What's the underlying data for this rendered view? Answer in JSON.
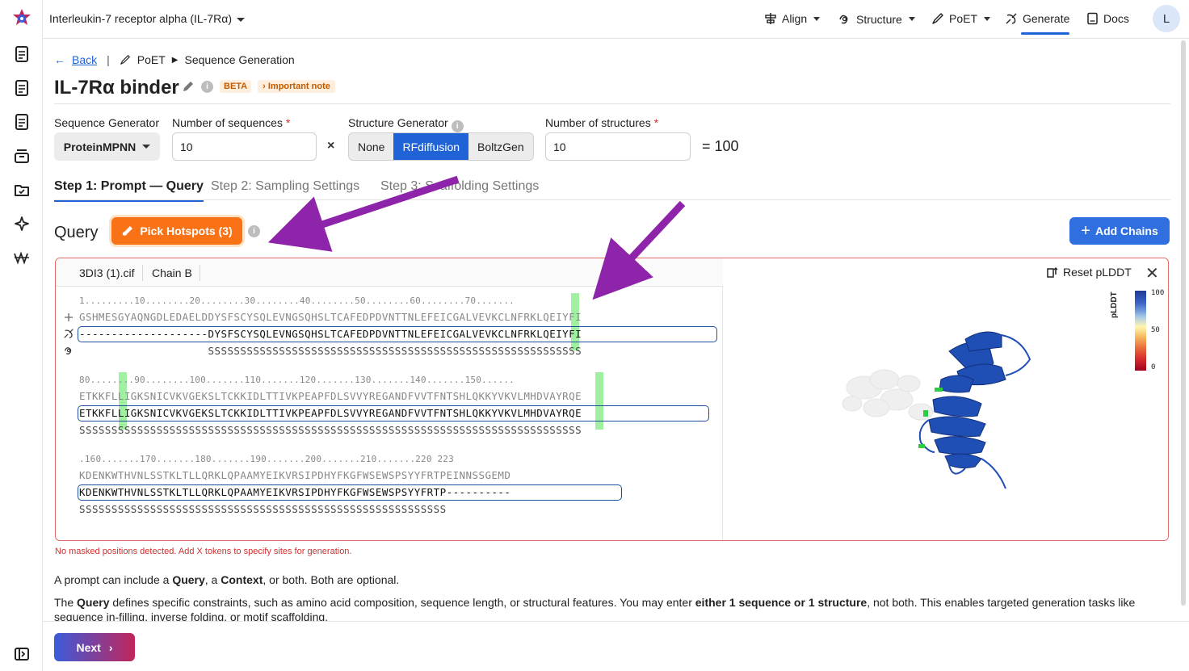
{
  "header": {
    "project_title": "Interleukin-7 receptor alpha (IL-7Rα)",
    "nav": [
      {
        "label": "Align",
        "icon": "align-icon"
      },
      {
        "label": "Structure",
        "icon": "structure-icon"
      },
      {
        "label": "PoET",
        "icon": "poet-icon"
      },
      {
        "label": "Generate",
        "icon": "generate-icon",
        "active": true
      },
      {
        "label": "Docs",
        "icon": "docs-icon"
      }
    ],
    "avatar": "L"
  },
  "breadcrumb": {
    "back": "Back",
    "separator": "|",
    "poet": "PoET",
    "current": "Sequence Generation"
  },
  "page": {
    "title": "IL-7Rα binder",
    "beta": "BETA",
    "note": "Important note"
  },
  "form": {
    "seq_gen_label": "Sequence Generator",
    "seq_gen_value": "ProteinMPNN",
    "num_seq_label": "Number of sequences",
    "num_seq_value": "10",
    "times": "×",
    "struct_gen_label": "Structure Generator",
    "struct_options": [
      "None",
      "RFdiffusion",
      "BoltzGen"
    ],
    "struct_selected": "RFdiffusion",
    "num_struct_label": "Number of structures",
    "num_struct_value": "10",
    "total": "= 100",
    "required_mark": "*",
    "info": "i"
  },
  "tabs": [
    {
      "label": "Step 1: Prompt — Query",
      "active": true
    },
    {
      "label": "Step 2: Sampling Settings"
    },
    {
      "label": "Step 3: Scaffolding Settings"
    }
  ],
  "query": {
    "label": "Query",
    "pick_hotspots": "Pick Hotspots (3)",
    "add_chains": "Add Chains",
    "file_name": "3DI3 (1).cif",
    "chain": "Chain B",
    "reset_plddt": "Reset pLDDT",
    "close": "✕",
    "plddt_label": "pLDDT",
    "plddt_ticks": [
      "100",
      "50",
      "0"
    ],
    "rows": [
      {
        "ruler": "1.........10........20........30........40........50........60........70.......",
        "ref": "GSHMESGYAQNGDLEDAELDDYSFSCYSQLEVNGSQHSLTCAFEDPDVNTTNLEFEICGALVEVKCLNFRKLQEIYFI",
        "query": "--------------------DYSFSCYSQLEVNGSQHSLTCAFEDPDVNTTNLEFEICGALVEVKCLNFRKLQEIYFI",
        "ss": "                    SSSSSSSSSSSSSSSSSSSSSSSSSSSSSSSSSSSSSSSSSSSSSSSSSSSSSSSSSS"
      },
      {
        "ruler": "80........90........100.......110.......120.......130.......140.......150......",
        "ref": "ETKKFLLIGKSNICVKVGEKSLTCKKIDLTTIVKPEAPFDLSVVYREGANDFVVTFNTSHLQKKYVKVLMHDVAYRQE",
        "query": "ETKKFLLIGKSNICVKVGEKSLTCKKIDLTTIVKPEAPFDLSVVYREGANDFVVTFNTSHLQKKYVKVLMHDVAYRQE",
        "ss": "SSSSSSSSSSSSSSSSSSSSSSSSSSSSSSSSSSSSSSSSSSSSSSSSSSSSSSSSSSSSSSSSSSSSSSSSSSSSSS"
      },
      {
        "ruler": ".160.......170.......180.......190.......200.......210.......220 223",
        "ref": "KDENKWTHVNLSSTKLTLLQRKLQPAAMYEIKVRSIPDHYFKGFWSEWSPSYYFRTPEINNSSGEMD",
        "query": "KDENKWTHVNLSSTKLTLLQRKLQPAAMYEIKVRSIPDHYFKGFWSEWSPSYYFRTP----------",
        "ss": "SSSSSSSSSSSSSSSSSSSSSSSSSSSSSSSSSSSSSSSSSSSSSSSSSSSSSSSSS"
      }
    ],
    "hotspots": [
      "V62",
      "L85",
      "Y144"
    ]
  },
  "warning": "No masked positions detected. Add X tokens to specify sites for generation.",
  "description": {
    "p1_a": "A prompt can include a ",
    "p1_b": "Query",
    "p1_c": ", a ",
    "p1_d": "Context",
    "p1_e": ", or both. Both are optional.",
    "p2_a": "The ",
    "p2_b": "Query",
    "p2_c": " defines specific constraints, such as amino acid composition, sequence length, or structural features. You may enter ",
    "p2_d": "either 1 sequence or 1 structure",
    "p2_e": ", not both. This enables targeted generation tasks like sequence in-filling, inverse folding, or motif scaffolding."
  },
  "footer": {
    "next": "Next"
  },
  "colors": {
    "primary": "#1f63d6",
    "pick": "#f97316",
    "annotation_arrow": "#8e24aa",
    "hotspot": "#6ee66e"
  }
}
